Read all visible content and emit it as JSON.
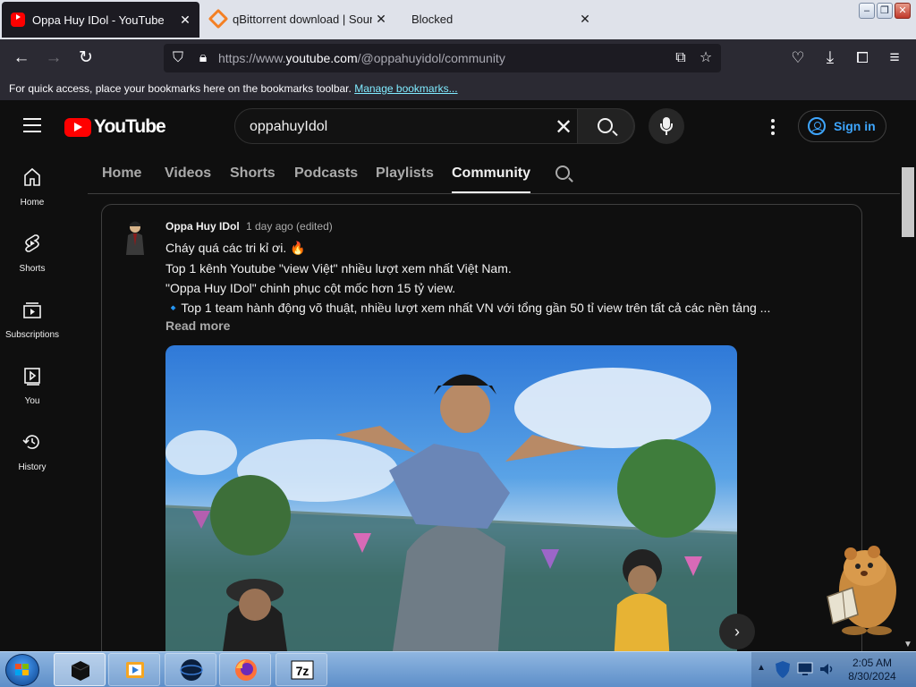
{
  "browser": {
    "tabs": [
      {
        "title": "Oppa Huy IDol - YouTube",
        "active": true
      },
      {
        "title": "qBittorrent download | SourceF",
        "active": false
      },
      {
        "title": "Blocked",
        "active": false
      }
    ],
    "url_prefix": "https://www.",
    "url_domain": "youtube.com",
    "url_path": "/@oppahuyidol/community",
    "bookmarks_text": "For quick access, place your bookmarks here on the bookmarks toolbar.",
    "bookmarks_link": "Manage bookmarks..."
  },
  "youtube": {
    "logo_text": "YouTube",
    "search_query": "oppahuyIdol",
    "sign_in": "Sign in",
    "guide": [
      {
        "label": "Home",
        "icon": "home-icon"
      },
      {
        "label": "Shorts",
        "icon": "shorts-icon"
      },
      {
        "label": "Subscriptions",
        "icon": "subscriptions-icon"
      },
      {
        "label": "You",
        "icon": "you-icon"
      },
      {
        "label": "History",
        "icon": "history-icon"
      }
    ],
    "channel_tabs": [
      "Home",
      "Videos",
      "Shorts",
      "Podcasts",
      "Playlists",
      "Community"
    ],
    "active_tab": "Community"
  },
  "post": {
    "author": "Oppa Huy IDol",
    "time": "1 day ago (edited)",
    "lines": [
      "Cháy quá các tri kỉ ơi. 🔥",
      "Top 1 kênh Youtube \"view Việt\" nhiều lượt xem nhất Việt Nam.",
      "\"Oppa Huy IDol\" chinh phục cột mốc hơn 15 tỷ view.",
      "🔹Top 1 team hành động võ thuật, nhiều lượt xem nhất VN với tổng gần 50 tỉ view trên tất cả các nền tảng ..."
    ],
    "read_more": "Read more"
  },
  "taskbar": {
    "time": "2:05 AM",
    "date": "8/30/2024"
  },
  "colors": {
    "yt_red": "#ff0000",
    "link_blue": "#3ea6ff",
    "bg": "#0f0f0f"
  }
}
